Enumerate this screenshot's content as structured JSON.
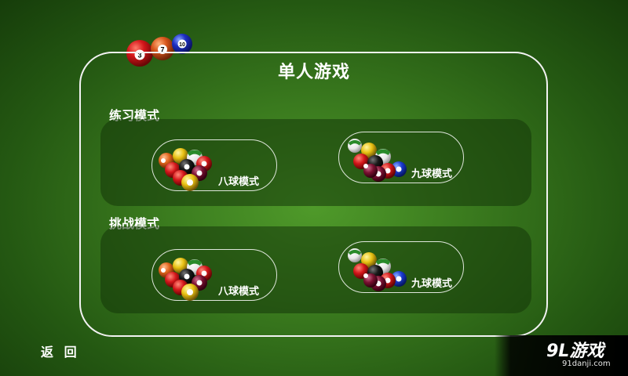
{
  "title": "单人游戏",
  "corner_balls": [
    "3",
    "7",
    "10"
  ],
  "sections": [
    {
      "label": "练习模式",
      "modes": [
        {
          "label": "八球模式"
        },
        {
          "label": "九球模式"
        }
      ]
    },
    {
      "label": "挑战模式",
      "modes": [
        {
          "label": "八球模式"
        },
        {
          "label": "九球模式"
        }
      ]
    }
  ],
  "back_label": "返 回",
  "logo": {
    "main": "9L游戏",
    "sub": "91danji.com"
  },
  "colors": {
    "felt": "#3a7a1e",
    "panel": "#1a4a0c",
    "outline": "#f2f2f2"
  }
}
